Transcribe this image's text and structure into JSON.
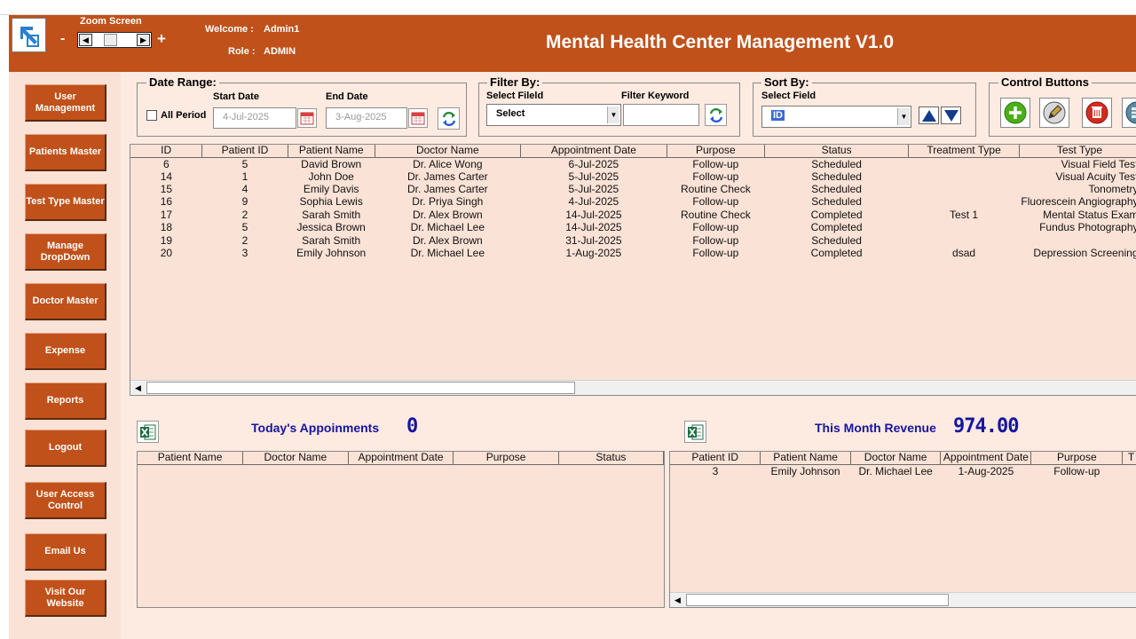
{
  "header": {
    "zoom_label": "Zoom Screen",
    "zoom_minus": "-",
    "zoom_plus": "+",
    "welcome_label": "Welcome :",
    "welcome_value": "Admin1",
    "role_label": "Role :",
    "role_value": "ADMIN",
    "title": "Mental Health Center Management  V1.0"
  },
  "sidebar": {
    "items": [
      {
        "label": "User Management"
      },
      {
        "label": "Patients Master"
      },
      {
        "label": "Test Type Master"
      },
      {
        "label": "Manage DropDown"
      },
      {
        "label": "Doctor Master"
      },
      {
        "label": "Expense"
      },
      {
        "label": "Reports"
      },
      {
        "label": "Logout"
      },
      {
        "label": "User Access Control"
      },
      {
        "label": "Email Us"
      },
      {
        "label": "Visit Our Website"
      }
    ]
  },
  "date_range": {
    "title": "Date Range:",
    "all_period_label": "All Period",
    "start_label": "Start Date",
    "start_value": "4-Jul-2025",
    "end_label": "End Date",
    "end_value": "3-Aug-2025"
  },
  "filter": {
    "title": "Filter By:",
    "field_label": "Select Fileld",
    "field_value": "Select",
    "keyword_label": "Filter Keyword",
    "keyword_value": ""
  },
  "sort": {
    "title": "Sort By:",
    "field_label": "Select Field",
    "field_value": "ID"
  },
  "control": {
    "title": "Control Buttons"
  },
  "main_table": {
    "columns": [
      "ID",
      "Patient ID",
      "Patient Name",
      "Doctor Name",
      "Appointment Date",
      "Purpose",
      "Status",
      "Treatment Type",
      "Test Type"
    ],
    "rows": [
      [
        "6",
        "5",
        "David Brown",
        "Dr. Alice Wong",
        "6-Jul-2025",
        "Follow-up",
        "Scheduled",
        "",
        "Visual Field Test"
      ],
      [
        "14",
        "1",
        "John Doe",
        "Dr. James Carter",
        "5-Jul-2025",
        "Follow-up",
        "Scheduled",
        "",
        "Visual Acuity Test"
      ],
      [
        "15",
        "4",
        "Emily Davis",
        "Dr. James Carter",
        "5-Jul-2025",
        "Routine Check",
        "Scheduled",
        "",
        "Tonometry"
      ],
      [
        "16",
        "9",
        "Sophia Lewis",
        "Dr. Priya Singh",
        "4-Jul-2025",
        "Follow-up",
        "Scheduled",
        "",
        "Fluorescein Angiography"
      ],
      [
        "17",
        "2",
        "Sarah Smith",
        "Dr. Alex Brown",
        "14-Jul-2025",
        "Routine Check",
        "Completed",
        "Test 1",
        "Mental Status Exam"
      ],
      [
        "18",
        "5",
        "Jessica Brown",
        "Dr. Michael Lee",
        "14-Jul-2025",
        "Follow-up",
        "Completed",
        "",
        "Fundus Photography"
      ],
      [
        "19",
        "2",
        "Sarah Smith",
        "Dr. Alex Brown",
        "31-Jul-2025",
        "Follow-up",
        "Scheduled",
        "",
        ""
      ],
      [
        "20",
        "3",
        "Emily Johnson",
        "Dr. Michael Lee",
        "1-Aug-2025",
        "Follow-up",
        "Completed",
        "dsad",
        "Depression Screening"
      ]
    ]
  },
  "today": {
    "label": "Today's Appoinments",
    "value": "0",
    "columns": [
      "Patient Name",
      "Doctor Name",
      "Appointment Date",
      "Purpose",
      "Status"
    ]
  },
  "revenue": {
    "label": "This Month Revenue",
    "value": "974.00",
    "columns": [
      "Patient ID",
      "Patient Name",
      "Doctor Name",
      "Appointment Date",
      "Purpose",
      "T"
    ],
    "rows": [
      [
        "3",
        "Emily Johnson",
        "Dr. Michael Lee",
        "1-Aug-2025",
        "Follow-up",
        ""
      ]
    ]
  },
  "colors": {
    "brand": "#c0511a",
    "panel": "#fdeae0",
    "accent_text": "#1515a0"
  }
}
